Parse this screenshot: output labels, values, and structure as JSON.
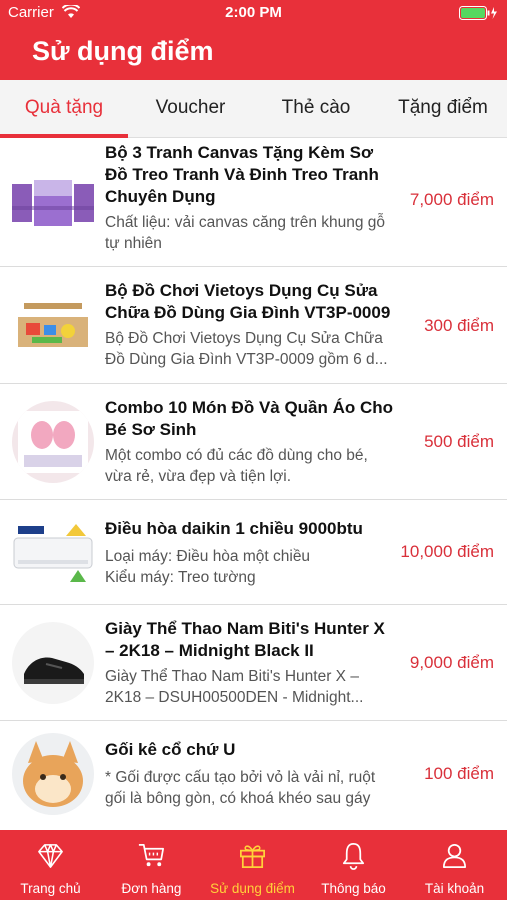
{
  "status_bar": {
    "carrier": "Carrier",
    "time": "2:00 PM"
  },
  "header": {
    "title": "Sử dụng điểm"
  },
  "tabs": [
    {
      "label": "Quà tặng"
    },
    {
      "label": "Voucher"
    },
    {
      "label": "Thẻ cào"
    },
    {
      "label": "Tặng điểm"
    }
  ],
  "items": [
    {
      "name": "Bộ 3 Tranh Canvas Tặng Kèm Sơ Đồ Treo Tranh Và Đinh Treo Tranh Chuyên Dụng",
      "desc": "Chất liệu: vải canvas căng trên khung gỗ tự nhiên",
      "points": "7,000 điểm"
    },
    {
      "name": "Bộ Đồ Chơi Vietoys Dụng Cụ Sửa Chữa Đồ Dùng Gia Đình VT3P-0009",
      "desc": "Bộ Đồ Chơi Vietoys Dụng Cụ Sửa Chữa Đồ Dùng Gia Đình VT3P-0009 gồm 6 d...",
      "points": "300 điểm"
    },
    {
      "name": "Combo 10 Món Đồ Và Quần Áo Cho Bé Sơ Sinh",
      "desc": "Một combo có đủ các đồ dùng cho bé, vừa rẻ, vừa đẹp và tiện lợi.",
      "points": "500 điểm"
    },
    {
      "name": "Điều hòa daikin 1 chiều 9000btu",
      "desc": "Loại máy: Điều hòa một chiều\nKiểu máy: Treo tường",
      "points": "10,000 điểm"
    },
    {
      "name": "Giày Thể Thao Nam Biti's Hunter X – 2K18 –  Midnight Black II",
      "desc": "Giày Thể Thao Nam Biti's Hunter X – 2K18 – DSUH00500DEN - Midnight...",
      "points": "9,000 điểm"
    },
    {
      "name": "Gối kê cổ chứ U",
      "desc": "* Gối được cấu tạo bởi vỏ là vải nỉ, ruột gối là bông gòn, có khoá khéo sau gáy",
      "points": "100 điểm"
    }
  ],
  "tab_bar": [
    {
      "label": "Trang chủ",
      "icon": "diamond-icon"
    },
    {
      "label": "Đơn hàng",
      "icon": "cart-icon"
    },
    {
      "label": "Sử dụng điểm",
      "icon": "gift-icon"
    },
    {
      "label": "Thông báo",
      "icon": "bell-icon"
    },
    {
      "label": "Tài khoản",
      "icon": "user-icon"
    }
  ],
  "colors": {
    "primary": "#e8303a",
    "active_tab_bar": "#ffd23a",
    "points": "#d9303a"
  }
}
